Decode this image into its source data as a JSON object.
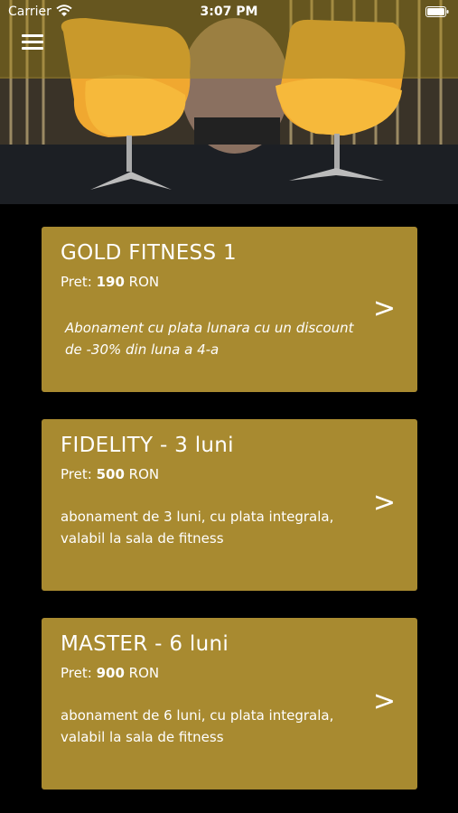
{
  "status_bar": {
    "carrier": "Carrier",
    "time": "3:07 PM"
  },
  "header": {
    "menu_icon": "hamburger-menu-icon"
  },
  "cards": [
    {
      "title": "GOLD FITNESS 1",
      "price_label": "Pret:",
      "price_value": "190",
      "currency": "RON",
      "description": "Abonament cu plata lunara cu un discount de -30% din luna a 4-a",
      "arrow": ">"
    },
    {
      "title": "FIDELITY - 3 luni",
      "price_label": "Pret:",
      "price_value": "500",
      "currency": "RON",
      "description": "abonament de 3 luni, cu plata integrala, valabil la sala de fitness",
      "arrow": ">"
    },
    {
      "title": "MASTER - 6 luni",
      "price_label": "Pret:",
      "price_value": "900",
      "currency": "RON",
      "description": "abonament de 6 luni, cu plata integrala, valabil la sala de fitness",
      "arrow": ">"
    }
  ],
  "colors": {
    "card_bg": "#a88a30",
    "background": "#000000",
    "chair": "#f0a830"
  }
}
